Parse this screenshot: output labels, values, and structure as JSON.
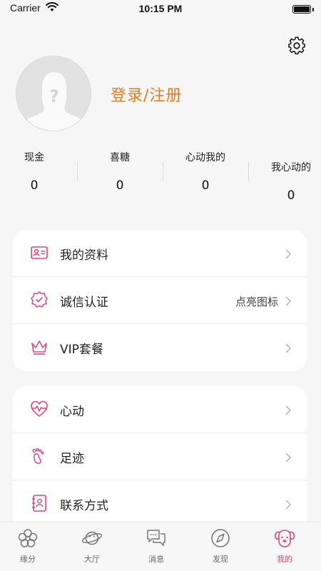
{
  "status_bar": {
    "carrier": "Carrier",
    "time": "10:15 PM"
  },
  "header": {
    "login_label": "登录/注册",
    "settings_icon": "gear-icon"
  },
  "stats": [
    {
      "label": "现金",
      "value": "0"
    },
    {
      "label": "喜糖",
      "value": "0"
    },
    {
      "label": "心动我的",
      "value": "0"
    },
    {
      "label": "我心动的",
      "value": "0"
    }
  ],
  "menu_group_1": [
    {
      "label": "我的资料",
      "icon": "id-card-icon",
      "value": ""
    },
    {
      "label": "诚信认证",
      "icon": "verified-badge-icon",
      "value": "点亮图标"
    },
    {
      "label": "VIP套餐",
      "icon": "crown-icon",
      "value": ""
    }
  ],
  "menu_group_2": [
    {
      "label": "心动",
      "icon": "heartbeat-icon"
    },
    {
      "label": "足迹",
      "icon": "footprint-icon"
    },
    {
      "label": "联系方式",
      "icon": "contact-book-icon"
    }
  ],
  "tabbar": [
    {
      "label": "缘分",
      "icon": "flower-icon"
    },
    {
      "label": "大厅",
      "icon": "planet-icon"
    },
    {
      "label": "消息",
      "icon": "chat-icon"
    },
    {
      "label": "发现",
      "icon": "compass-icon"
    },
    {
      "label": "我的",
      "icon": "dog-face-icon",
      "active": true
    }
  ],
  "colors": {
    "accent": "#e0467a",
    "login": "#f07a1a",
    "background": "#f6f6f6"
  }
}
